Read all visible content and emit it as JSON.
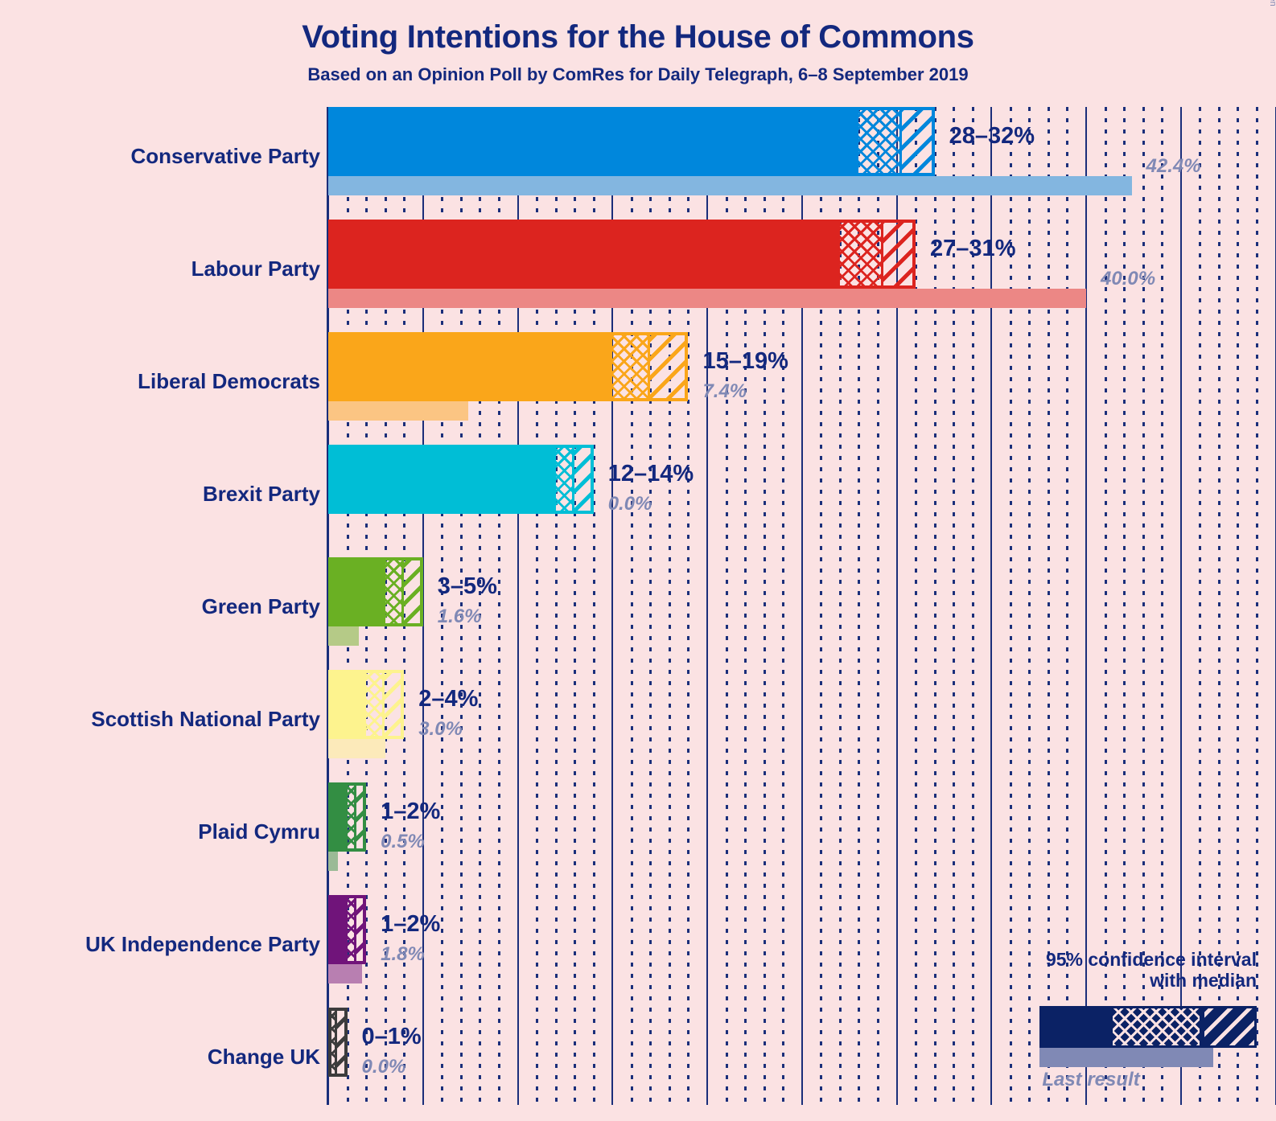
{
  "header": {
    "title": "Voting Intentions for the House of Commons",
    "subtitle": "Based on an Opinion Poll by ComRes for Daily Telegraph, 6–8 September 2019"
  },
  "copyright": "© 2019 Filip van Laenen",
  "legend": {
    "title": "95% confidence interval\nwith median",
    "last_result_label": "Last result"
  },
  "chart_data": {
    "type": "bar",
    "title": "Voting Intentions for the House of Commons",
    "subtitle": "Based on an Opinion Poll by ComRes for Daily Telegraph, 6–8 September 2019",
    "xlabel": "",
    "ylabel": "",
    "xlim": [
      0,
      50
    ],
    "grid": {
      "major_step": 5,
      "minor_step": 1,
      "orientation": "vertical"
    },
    "legend_position": "bottom-right",
    "value_unit": "%",
    "categories": [
      "Conservative Party",
      "Labour Party",
      "Liberal Democrats",
      "Brexit Party",
      "Green Party",
      "Scottish National Party",
      "Plaid Cymru",
      "UK Independence Party",
      "Change UK"
    ],
    "series": [
      {
        "name": "95% confidence interval with median",
        "parties": [
          {
            "party": "Conservative Party",
            "ci_label": "28–32%",
            "ci_low": 28,
            "ci_high": 32,
            "median": 30.2,
            "color": "#0087DC"
          },
          {
            "party": "Labour Party",
            "ci_label": "27–31%",
            "ci_low": 27,
            "ci_high": 31,
            "median": 29.2,
            "color": "#DC241F"
          },
          {
            "party": "Liberal Democrats",
            "ci_label": "15–19%",
            "ci_low": 15,
            "ci_high": 19,
            "median": 16.9,
            "color": "#FAA61A"
          },
          {
            "party": "Brexit Party",
            "ci_label": "12–14%",
            "ci_low": 12,
            "ci_high": 14,
            "median": 12.9,
            "color": "#00BED6"
          },
          {
            "party": "Green Party",
            "ci_label": "3–5%",
            "ci_low": 3,
            "ci_high": 5,
            "median": 3.9,
            "color": "#6AB023"
          },
          {
            "party": "Scottish National Party",
            "ci_label": "2–4%",
            "ci_low": 2,
            "ci_high": 4,
            "median": 2.9,
            "color": "#FDF38E"
          },
          {
            "party": "Plaid Cymru",
            "ci_label": "1–2%",
            "ci_low": 1,
            "ci_high": 2,
            "median": 1.4,
            "color": "#338E43"
          },
          {
            "party": "UK Independence Party",
            "ci_label": "1–2%",
            "ci_low": 1,
            "ci_high": 2,
            "median": 1.4,
            "color": "#70147A"
          },
          {
            "party": "Change UK",
            "ci_label": "0–1%",
            "ci_low": 0,
            "ci_high": 1,
            "median": 0.4,
            "color": "#3C3C3C"
          }
        ]
      },
      {
        "name": "Last result",
        "values": [
          42.4,
          40.0,
          7.4,
          0.0,
          1.6,
          3.0,
          0.5,
          1.8,
          0.0
        ],
        "labels": [
          "42.4%",
          "40.0%",
          "7.4%",
          "0.0%",
          "1.6%",
          "3.0%",
          "0.5%",
          "1.8%",
          "0.0%"
        ]
      }
    ],
    "colors": {
      "background": "#FBE2E3",
      "text": "#13287E",
      "axis": "#1A2E7A",
      "last_result_text": "#8089B5",
      "legend_bar": "#0B2265",
      "last_result_bar": "#8089B5"
    }
  }
}
